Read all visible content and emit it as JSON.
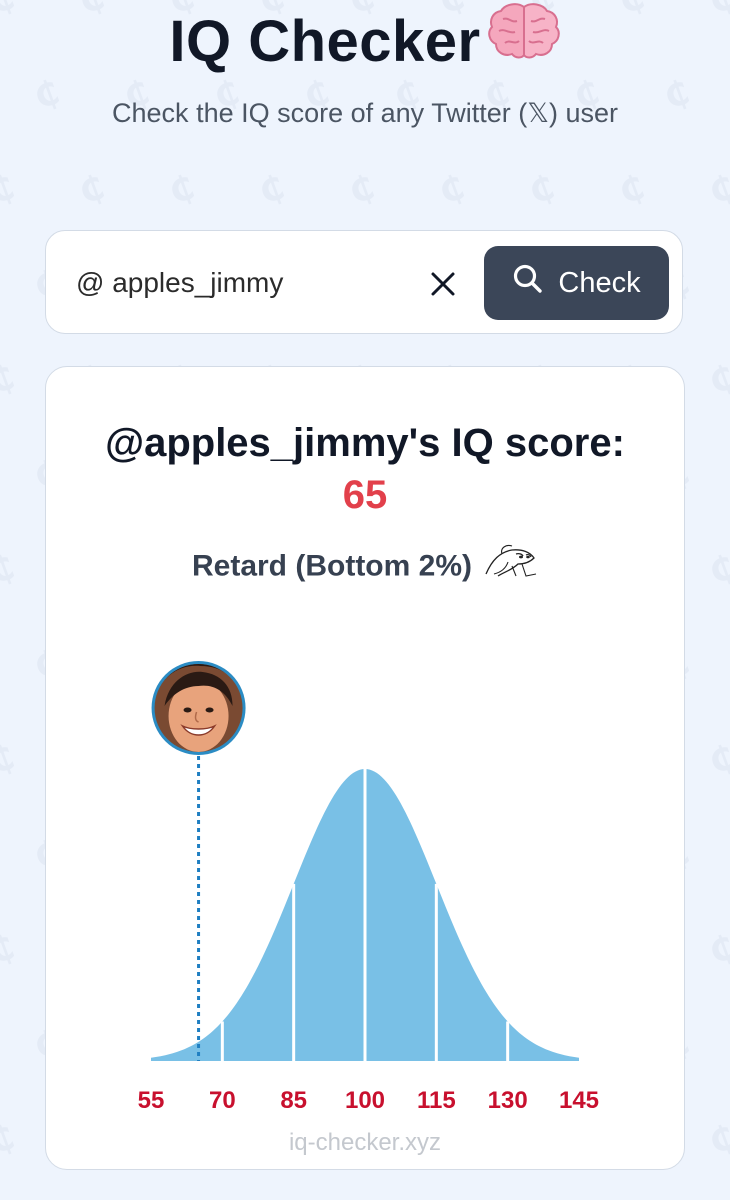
{
  "app": {
    "title": "IQ Checker",
    "title_emoji": "brain",
    "subtitle": "Check the IQ score of any Twitter (𝕏) user"
  },
  "search": {
    "value": "@ apples_jimmy",
    "clear_icon": "close-icon",
    "button_label": "Check",
    "button_icon": "search-icon"
  },
  "result": {
    "heading": "@apples_jimmy's IQ score:",
    "score": "65",
    "category": "Retard (Bottom 2%)",
    "category_icon": "wojak-sketch-icon",
    "watermark": "iq-checker.xyz"
  },
  "colors": {
    "page_background": "#eef4fd",
    "button_bg": "#3b4658",
    "score_red": "#e2404b",
    "curve_fill": "#79c0e6",
    "marker_blue": "#1f7fc2",
    "tick_red": "#c8102e"
  },
  "chart_data": {
    "type": "area",
    "distribution": "normal",
    "mean": 100,
    "sd": 15,
    "xlim": [
      55,
      145
    ],
    "x_ticks": [
      "55",
      "70",
      "85",
      "100",
      "115",
      "130",
      "145"
    ],
    "section_dividers": [
      70,
      85,
      100,
      115,
      130
    ],
    "marker": {
      "value": 65,
      "avatar": "user-avatar"
    }
  }
}
